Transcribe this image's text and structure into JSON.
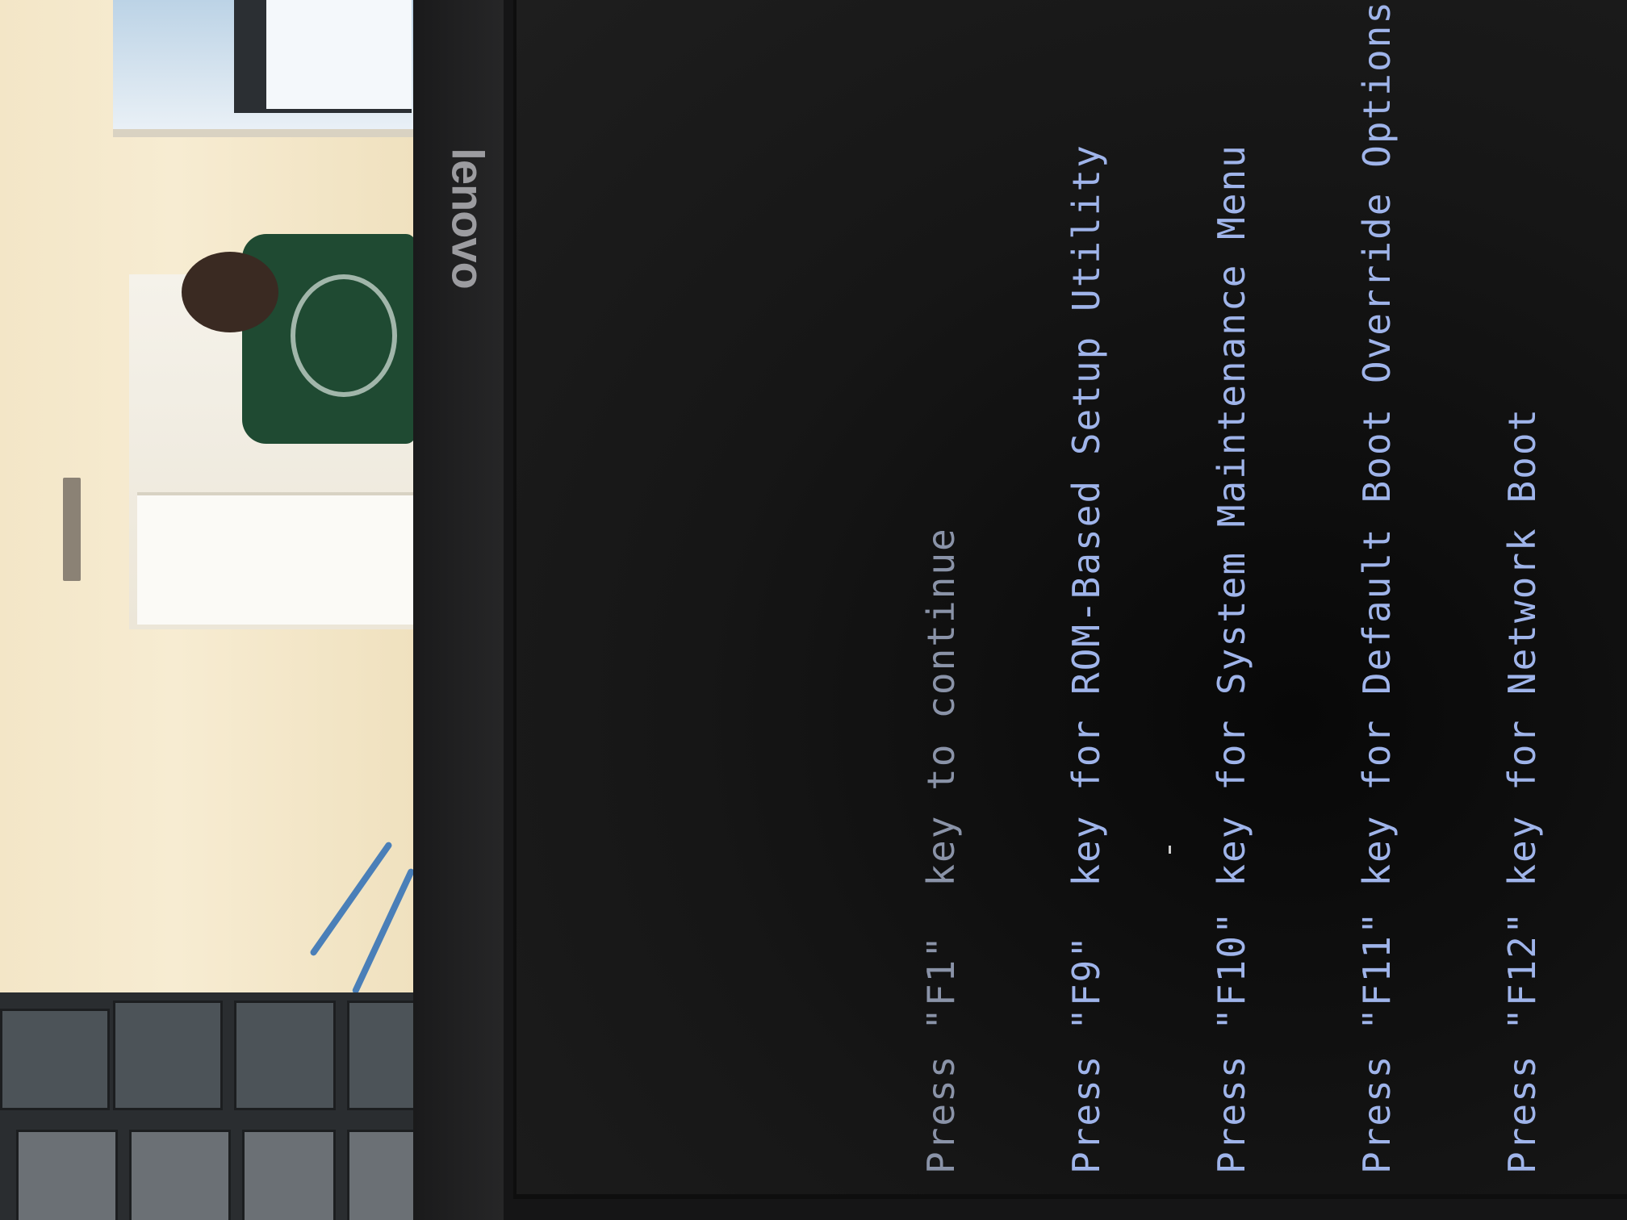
{
  "monitor": {
    "brand": "lenovo"
  },
  "post_screen": {
    "lines": [
      "Press \"F1\"  key to continue",
      "Press \"F9\"  key for ROM-Based Setup Utility",
      "Press \"F10\" key for System Maintenance Menu",
      "Press \"F11\" key for Default Boot Override Options",
      "Press \"F12\" key for Network Boot"
    ]
  },
  "colors": {
    "post_text": "#9fb4ea",
    "screen_bg": "#121212",
    "bezel": "#1a1a1b"
  }
}
